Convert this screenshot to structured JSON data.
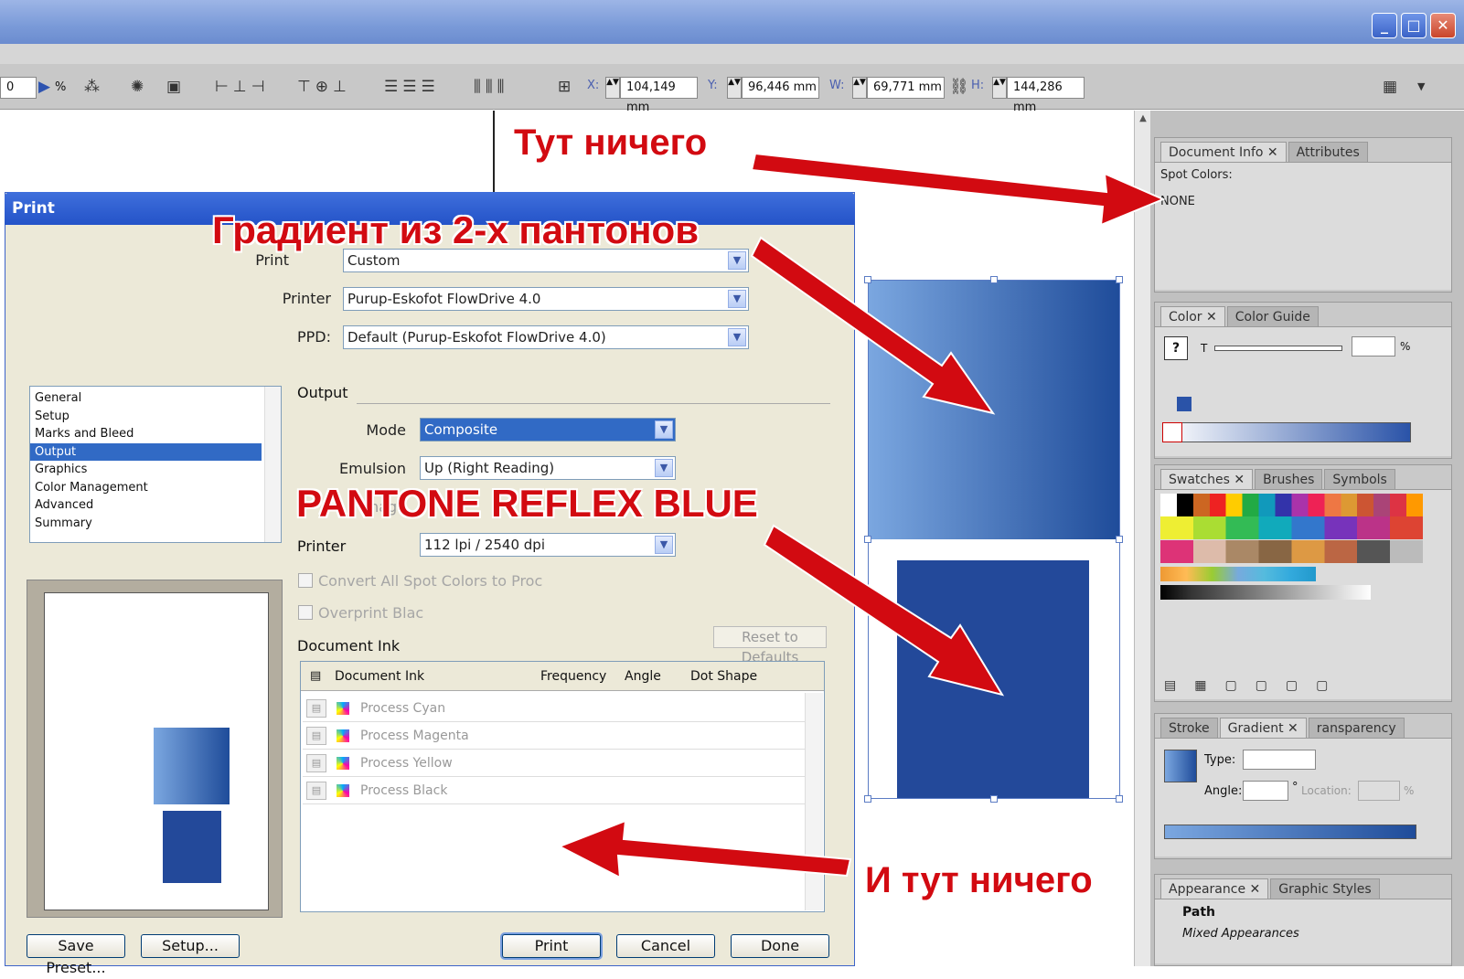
{
  "window": {
    "minimize": "_",
    "maximize": "□",
    "close": "✕"
  },
  "toolbar": {
    "zoom_value": "0",
    "percent": "%",
    "x_label": "X:",
    "x_value": "104,149 mm",
    "y_label": "Y:",
    "y_value": "96,446 mm",
    "w_label": "W:",
    "w_value": "69,771 mm",
    "h_label": "H:",
    "h_value": "144,286 mm"
  },
  "dialog": {
    "title": "Print",
    "print_label": "Print",
    "print_value": "Custom",
    "printer_label": "Printer",
    "printer_value": "Purup-Eskofot FlowDrive 4.0",
    "ppd_label": "PPD:",
    "ppd_value": "Default (Purup-Eskofot FlowDrive 4.0)",
    "nav": [
      "General",
      "Setup",
      "Marks and Bleed",
      "Output",
      "Graphics",
      "Color Management",
      "Advanced",
      "Summary"
    ],
    "nav_selected": "Output",
    "output_header": "Output",
    "mode_label": "Mode",
    "mode_value": "Composite",
    "emulsion_label": "Emulsion",
    "emulsion_value": "Up (Right Reading)",
    "image_label": "Image",
    "printer_res_label": "Printer",
    "printer_res_value": "112 lpi / 2540 dpi",
    "convert_spot": "Convert All Spot Colors to Proc",
    "overprint": "Overprint Blac",
    "doc_ink_label": "Document Ink",
    "reset": "Reset to Defaults",
    "ink_columns": [
      "Document Ink",
      "Frequency",
      "Angle",
      "Dot Shape"
    ],
    "inks": [
      "Process Cyan",
      "Process Magenta",
      "Process Yellow",
      "Process Black"
    ],
    "buttons": {
      "save_preset": "Save Preset...",
      "setup": "Setup...",
      "print": "Print",
      "cancel": "Cancel",
      "done": "Done"
    }
  },
  "panels": {
    "docinfo": {
      "tabs": [
        "Document Info",
        "Attributes"
      ],
      "heading": "Spot Colors:",
      "value": "NONE"
    },
    "color": {
      "tabs": [
        "Color",
        "Color Guide"
      ],
      "t_label": "T",
      "percent": "%",
      "question": "?"
    },
    "swatches": {
      "tabs": [
        "Swatches",
        "Brushes",
        "Symbols"
      ]
    },
    "gradient": {
      "tabs": [
        "Stroke",
        "Gradient",
        "ransparency"
      ],
      "type_label": "Type:",
      "angle_label": "Angle:",
      "degree": "°",
      "location_label": "Location:",
      "location_pct": "%"
    },
    "appearance": {
      "tabs": [
        "Appearance",
        "Graphic Styles"
      ],
      "path": "Path",
      "mixed": "Mixed Appearances"
    }
  },
  "annotations": {
    "nothing_here": "Тут ничего",
    "gradient_two": "Градиент из 2-х пантонов",
    "reflex_blue": "PANTONE REFLEX BLUE",
    "and_nothing": "И тут ничего"
  },
  "colors": {
    "accent": "#316ac5",
    "gradient_start": "#7ba7e0",
    "gradient_end": "#1f4c9a",
    "reflex": "#23499a",
    "annotation": "#d20a11"
  }
}
